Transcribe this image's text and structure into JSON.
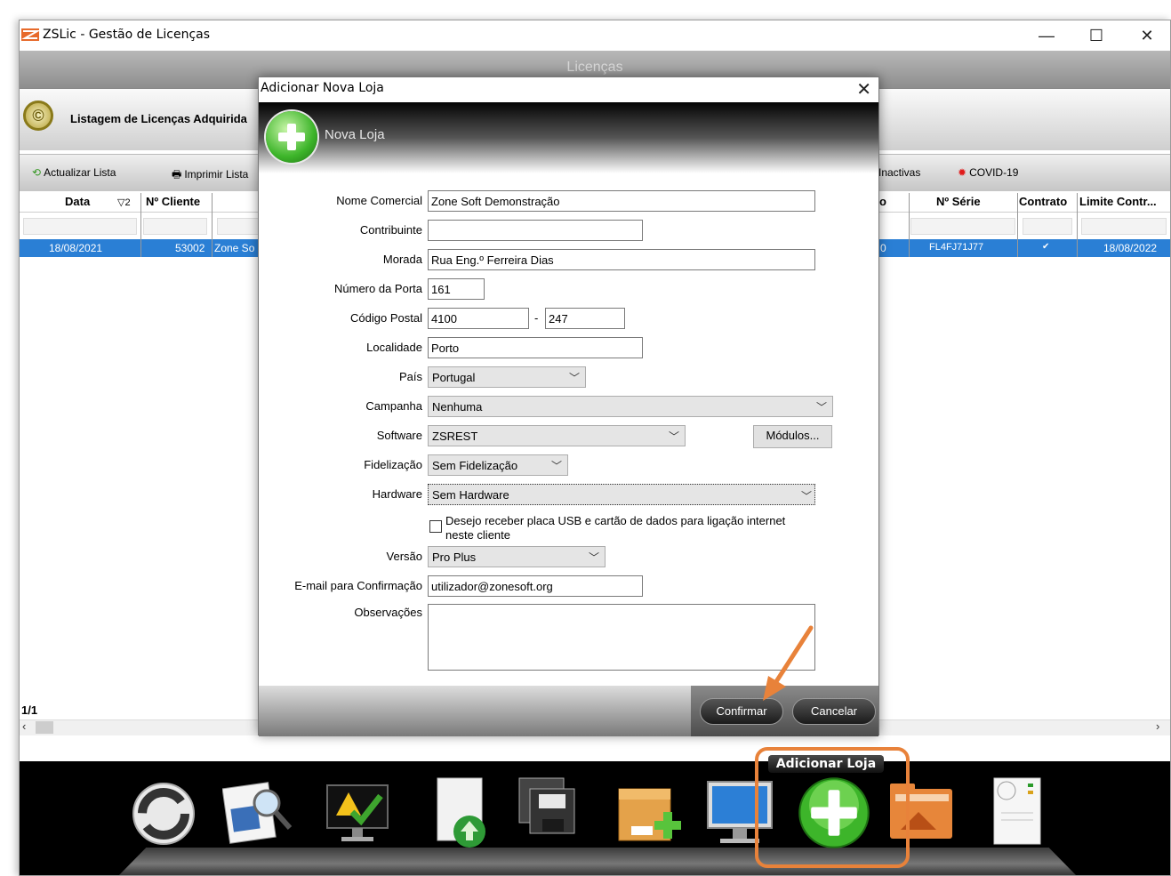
{
  "window": {
    "title": "ZSLic - Gestão de Licenças",
    "minimize": "—",
    "maximize": "☐",
    "close": "✕"
  },
  "header": {
    "title": "Licenças",
    "subtitle": "Listagem de Licenças Adquirida"
  },
  "toolbar": {
    "refresh": "Actualizar Lista",
    "print": "Imprimir Lista",
    "inactive": "Inactivas",
    "covid": "COVID-19"
  },
  "grid": {
    "columns": {
      "data": "Data",
      "sort": "▽2",
      "client": "Nº Cliente",
      "o": "o",
      "serie": "Nº Série",
      "contrato": "Contrato",
      "limite": "Limite Contr..."
    },
    "row": {
      "data": "18/08/2021",
      "client": "53002",
      "name": "Zone So",
      "o": "0",
      "serie": "FL4FJ71J77",
      "contrato": "✔",
      "limite": "18/08/2022"
    },
    "pager": "1/1"
  },
  "dialog": {
    "title": "Adicionar Nova Loja",
    "close": "✕",
    "header": "Nova Loja",
    "fields": {
      "nome_label": "Nome Comercial",
      "nome_value": "Zone Soft Demonstração",
      "contrib_label": "Contribuinte",
      "contrib_value": "",
      "morada_label": "Morada",
      "morada_value": "Rua Eng.º Ferreira Dias",
      "porta_label": "Número da Porta",
      "porta_value": "161",
      "cp_label": "Código Postal",
      "cp1_value": "4100",
      "cp_sep": "-",
      "cp2_value": "247",
      "local_label": "Localidade",
      "local_value": "Porto",
      "pais_label": "País",
      "pais_value": "Portugal",
      "campanha_label": "Campanha",
      "campanha_value": "Nenhuma",
      "software_label": "Software",
      "software_value": "ZSREST",
      "modulos": "Módulos...",
      "fidel_label": "Fidelização",
      "fidel_value": "Sem Fidelização",
      "hardware_label": "Hardware",
      "hardware_value": "Sem Hardware",
      "checkbox_text_1": "Desejo receber placa USB e cartão de dados para ligação internet",
      "checkbox_text_2": "neste cliente",
      "versao_label": "Versão",
      "versao_value": "Pro Plus",
      "email_label": "E-mail para Confirmação",
      "email_value": "utilizador@zonesoft.org",
      "obs_label": "Observações",
      "obs_value": ""
    },
    "confirm": "Confirmar",
    "cancel": "Cancelar"
  },
  "dock": {
    "tooltip": "Adicionar Loja",
    "highlight_color": "#e8823a",
    "icons": [
      "refresh-icon",
      "search-document-icon",
      "warning-monitor-icon",
      "upload-document-icon",
      "save-icon",
      "package-add-icon",
      "monitor-icon",
      "add-store-icon",
      "folder-icon",
      "at-document-icon"
    ]
  }
}
